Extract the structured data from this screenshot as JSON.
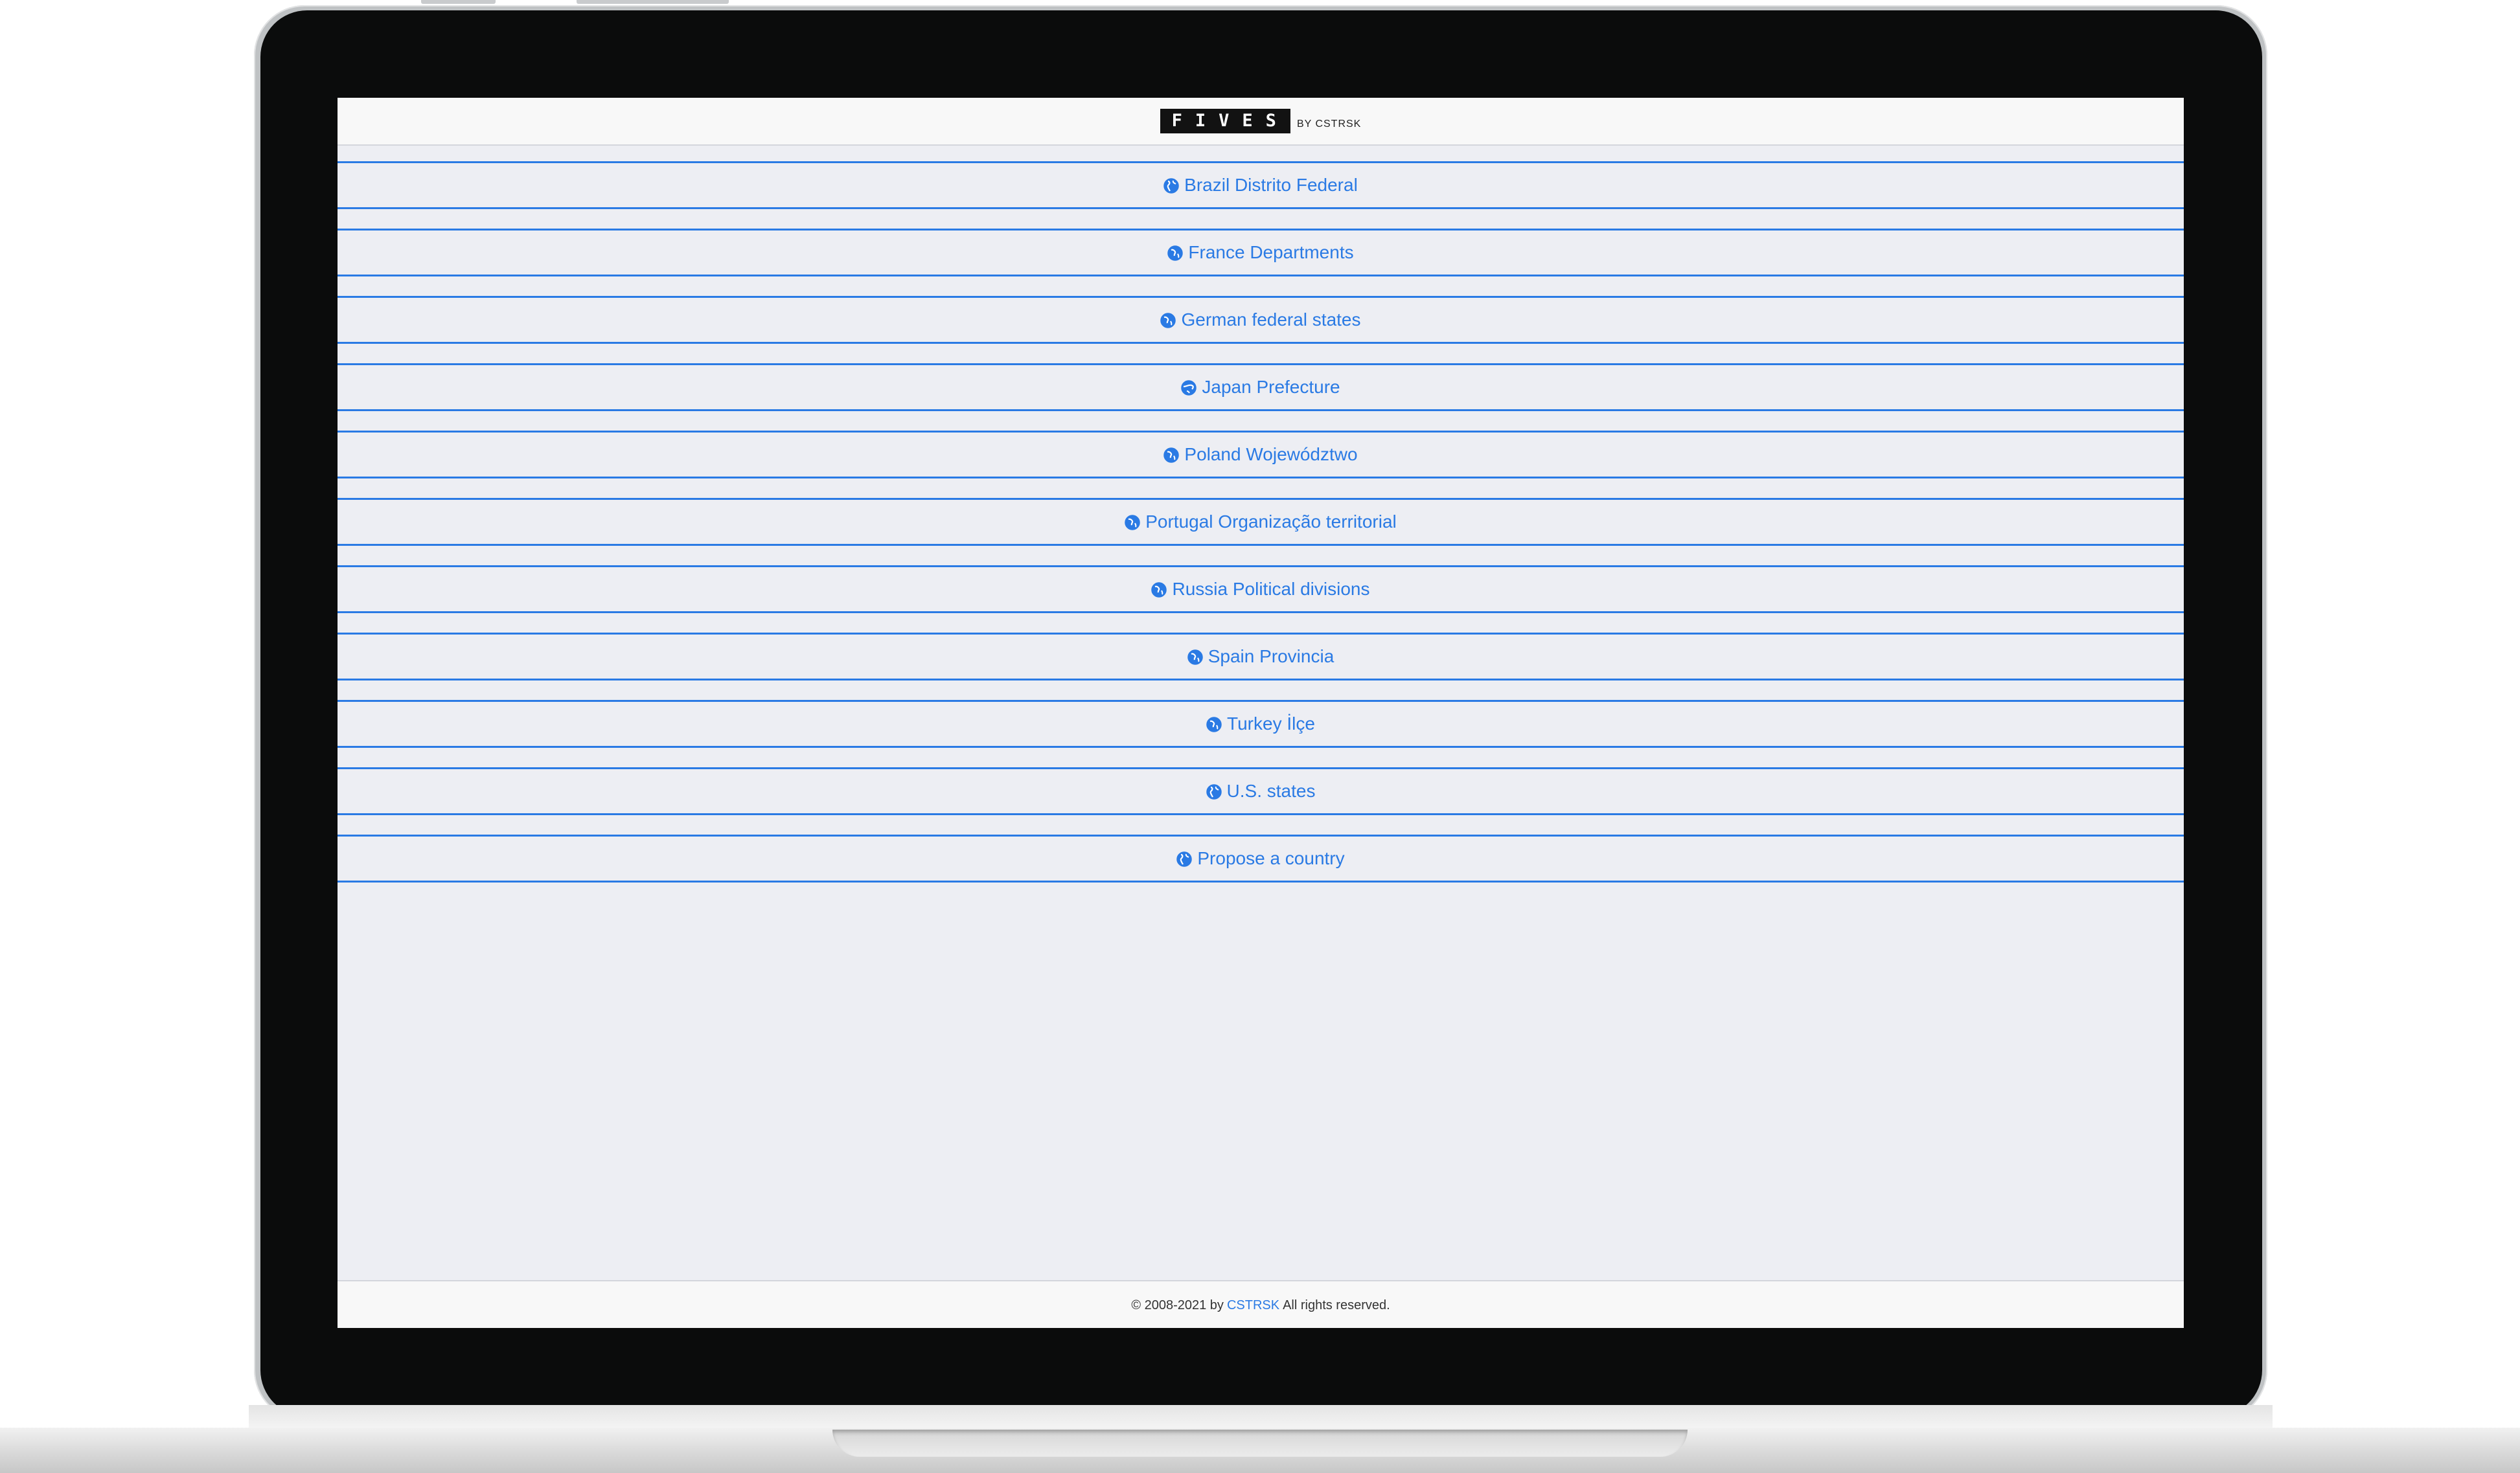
{
  "header": {
    "logo_text": "FIVES",
    "logo_byline": "BY CSTRSK"
  },
  "nav": {
    "items": [
      {
        "label": "Brazil Distrito Federal",
        "icon": "globe-americas-icon"
      },
      {
        "label": "France Departments",
        "icon": "globe-europe-icon"
      },
      {
        "label": "German federal states",
        "icon": "globe-europe-icon"
      },
      {
        "label": "Japan Prefecture",
        "icon": "globe-asia-icon"
      },
      {
        "label": "Poland Województwo",
        "icon": "globe-europe-icon"
      },
      {
        "label": "Portugal Organização territorial",
        "icon": "globe-europe-icon"
      },
      {
        "label": "Russia Political divisions",
        "icon": "globe-europe-icon"
      },
      {
        "label": "Spain Provincia",
        "icon": "globe-europe-icon"
      },
      {
        "label": "Turkey İlçe",
        "icon": "globe-europe-icon"
      },
      {
        "label": "U.S. states",
        "icon": "globe-americas-icon"
      },
      {
        "label": "Propose a country",
        "icon": "globe-americas-icon"
      }
    ]
  },
  "footer": {
    "copyright": "© 2008-2021 by",
    "link_text": "CSTRSK",
    "suffix": "All rights reserved."
  },
  "colors": {
    "accent": "#2a7ae4",
    "screen_background": "#edeef3",
    "header_background": "#f8f8f8",
    "bezel": "#0b0c0c"
  }
}
